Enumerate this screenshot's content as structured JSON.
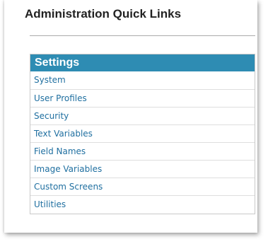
{
  "page_title": "Administration Quick Links",
  "settings": {
    "header": "Settings",
    "items": [
      {
        "label": "System"
      },
      {
        "label": "User Profiles"
      },
      {
        "label": "Security"
      },
      {
        "label": "Text Variables"
      },
      {
        "label": "Field Names"
      },
      {
        "label": "Image Variables"
      },
      {
        "label": "Custom Screens"
      },
      {
        "label": "Utilities"
      }
    ]
  },
  "colors": {
    "header_bg": "#2e8cb3",
    "link": "#1f6fa0",
    "title_text": "#222222"
  }
}
